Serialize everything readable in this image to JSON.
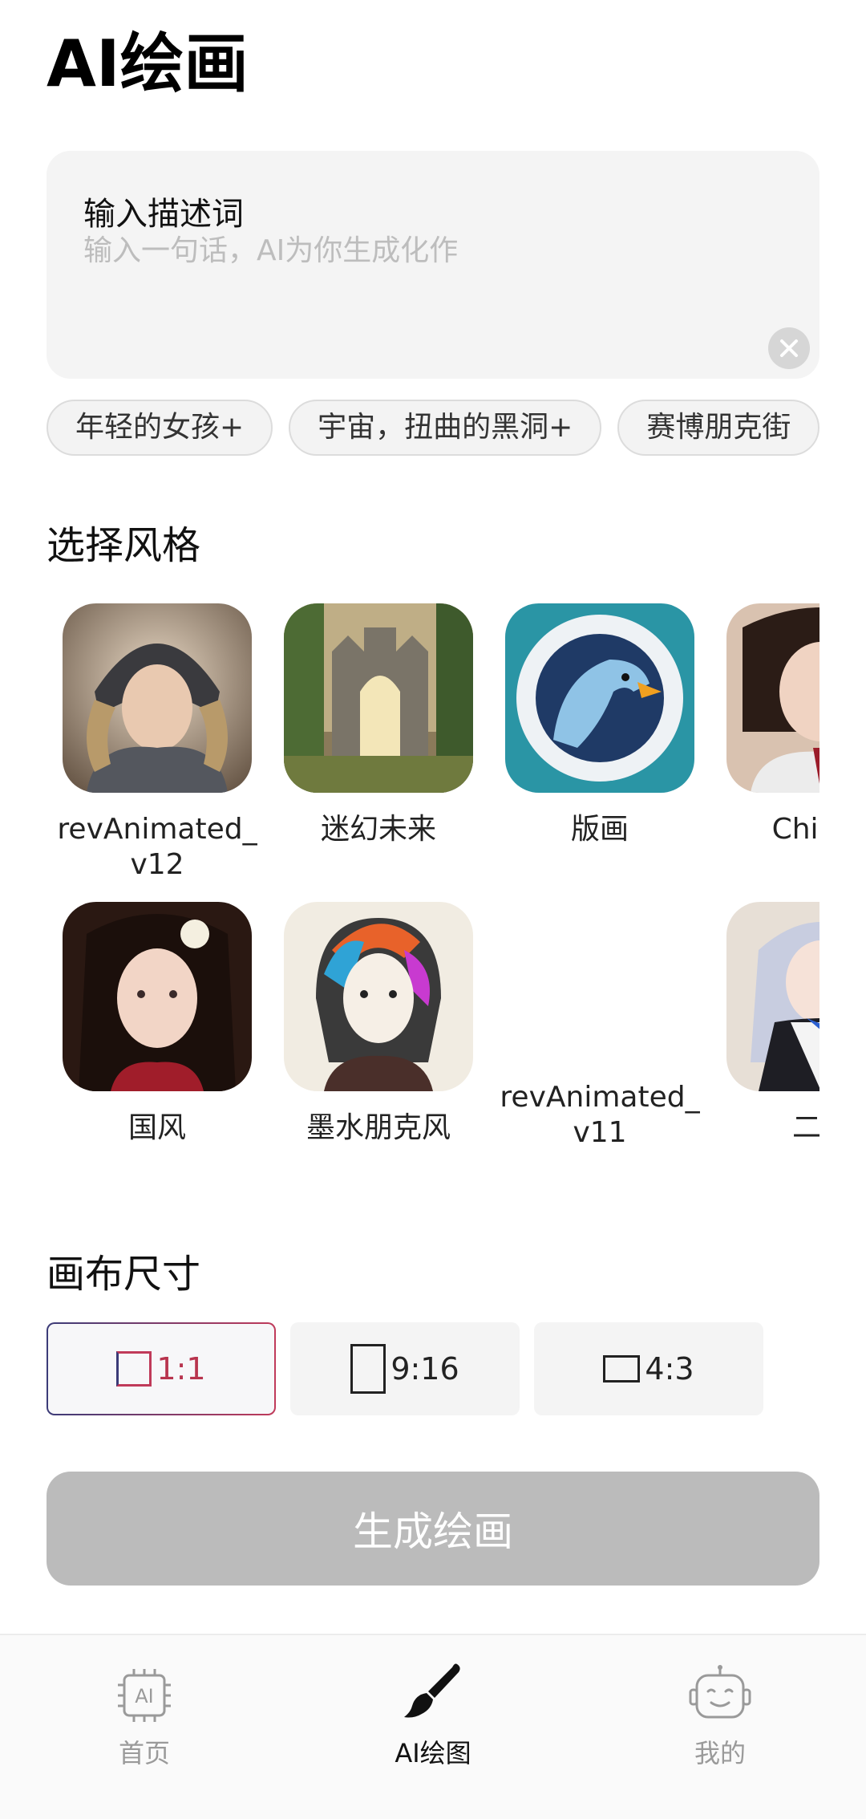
{
  "header": {
    "title": "AI绘画"
  },
  "prompt": {
    "label": "输入描述词",
    "placeholder": "输入一句话，AI为你生成化作"
  },
  "chips": [
    "年轻的女孩+",
    "宇宙，扭曲的黑洞+",
    "赛博朋克街"
  ],
  "style_section": {
    "title": "选择风格"
  },
  "styles": [
    {
      "label": "revAnimated_\nv12",
      "icon": "armored-knight-girl-image"
    },
    {
      "label": "迷幻未来",
      "icon": "castle-forest-image"
    },
    {
      "label": "版画",
      "icon": "paper-eagle-image"
    },
    {
      "label": "Chillou",
      "icon": "qipao-girl-image"
    },
    {
      "label": "国风",
      "icon": "chinese-style-girl-image"
    },
    {
      "label": "墨水朋克风",
      "icon": "ink-punk-girl-image"
    },
    {
      "label": "revAnimated_\nv11",
      "icon": ""
    },
    {
      "label": "二次",
      "icon": "anime-maid-image"
    }
  ],
  "canvas_section": {
    "title": "画布尺寸"
  },
  "ratios": [
    {
      "label": "1:1",
      "selected": true
    },
    {
      "label": "9:16",
      "selected": false
    },
    {
      "label": "4:3",
      "selected": false
    }
  ],
  "generate_button": {
    "label": "生成绘画"
  },
  "nav": {
    "items": [
      {
        "label": "首页",
        "icon": "ai-chip-icon",
        "active": false
      },
      {
        "label": "AI绘图",
        "icon": "paint-brush-icon",
        "active": true
      },
      {
        "label": "我的",
        "icon": "robot-face-icon",
        "active": false
      }
    ],
    "chip_text": "AI"
  },
  "colors": {
    "accent_start": "#3b3b78",
    "accent_end": "#c03a5a",
    "disabled_button": "#bbbbbb",
    "input_bg": "#f4f4f4"
  }
}
